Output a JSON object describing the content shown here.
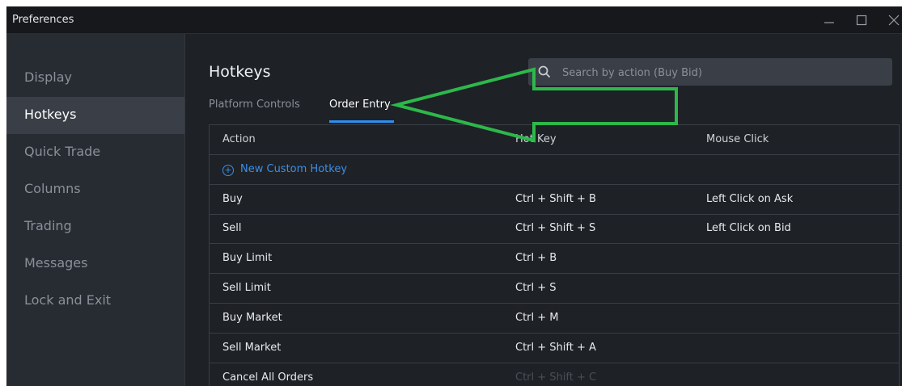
{
  "window": {
    "title": "Preferences"
  },
  "sidebar": {
    "items": [
      {
        "label": "Display"
      },
      {
        "label": "Hotkeys"
      },
      {
        "label": "Quick Trade"
      },
      {
        "label": "Columns"
      },
      {
        "label": "Trading"
      },
      {
        "label": "Messages"
      },
      {
        "label": "Lock and Exit"
      }
    ],
    "active": "Hotkeys"
  },
  "main": {
    "title": "Hotkeys",
    "search": {
      "placeholder": "Search by action (Buy Bid)",
      "value": ""
    },
    "tabs": [
      {
        "label": "Platform Controls"
      },
      {
        "label": "Order Entry"
      }
    ],
    "active_tab": "Order Entry"
  },
  "table": {
    "headers": [
      "Action",
      "Hot Key",
      "Mouse Click"
    ],
    "new_label": "New Custom Hotkey",
    "rows": [
      {
        "action": "Buy",
        "hotkey": "Ctrl + Shift + B",
        "mouse": "Left Click on Ask"
      },
      {
        "action": "Sell",
        "hotkey": "Ctrl + Shift + S",
        "mouse": "Left Click on Bid"
      },
      {
        "action": "Buy Limit",
        "hotkey": "Ctrl + B",
        "mouse": ""
      },
      {
        "action": "Sell Limit",
        "hotkey": "Ctrl + S",
        "mouse": ""
      },
      {
        "action": "Buy Market",
        "hotkey": "Ctrl + M",
        "mouse": ""
      },
      {
        "action": "Sell Market",
        "hotkey": "Ctrl + Shift + A",
        "mouse": ""
      },
      {
        "action": "Cancel All Orders",
        "hotkey": "Ctrl + Shift + C",
        "mouse": ""
      }
    ]
  },
  "annotation": {
    "color": "#2db84a"
  },
  "colors": {
    "accent": "#2f8ef0",
    "link": "#3b8fe8"
  }
}
